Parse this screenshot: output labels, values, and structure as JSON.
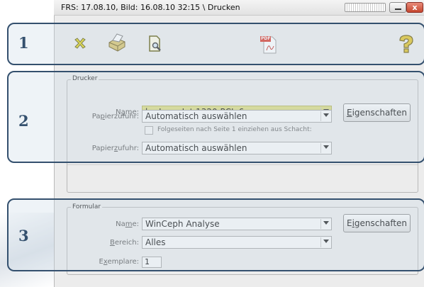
{
  "window": {
    "title": "FRS: 17.08.10,  Bild: 16.08.10  32:15 \\ Drucken",
    "close_glyph": "x"
  },
  "callouts": [
    "1",
    "2",
    "3"
  ],
  "toolbar": {
    "icons": [
      "close-icon",
      "printer-icon",
      "print-preview-icon",
      "pdf-icon",
      "help-icon"
    ],
    "pdf_badge": "PDF"
  },
  "drucker": {
    "group_title": "Drucker",
    "name_label_pre": "N",
    "name_label_u": "a",
    "name_label_post": "me:",
    "name_value": "hp LaserJet 1320 PCL 6",
    "eigenschaften_pre": "",
    "eigenschaften_u": "E",
    "eigenschaften_post": "igenschaften",
    "papier1_label_pre": "Pa",
    "papier1_label_u": "p",
    "papier1_label_post": "ierzufuhr:",
    "papier1_value": "Automatisch auswählen",
    "checkbox_label": "Folgeseiten nach Seite 1 einziehen aus Schacht:",
    "papier2_label_pre": "Papier",
    "papier2_label_u": "z",
    "papier2_label_post": "ufuhr:",
    "papier2_value": "Automatisch auswählen"
  },
  "formular": {
    "group_title": "Formular",
    "name_label_pre": "Na",
    "name_label_u": "m",
    "name_label_post": "e:",
    "name_value": "WinCeph Analyse",
    "eigenschaften_pre": "E",
    "eigenschaften_u": "i",
    "eigenschaften_post": "genschaften",
    "bereich_label_pre": "",
    "bereich_label_u": "B",
    "bereich_label_post": "ereich:",
    "bereich_value": "Alles",
    "exemplare_label_pre": "E",
    "exemplare_label_u": "x",
    "exemplare_label_post": "emplare:",
    "exemplare_value": "1"
  },
  "colors": {
    "callout_border": "#34506e",
    "highlight_combo": "#dcdc82"
  }
}
